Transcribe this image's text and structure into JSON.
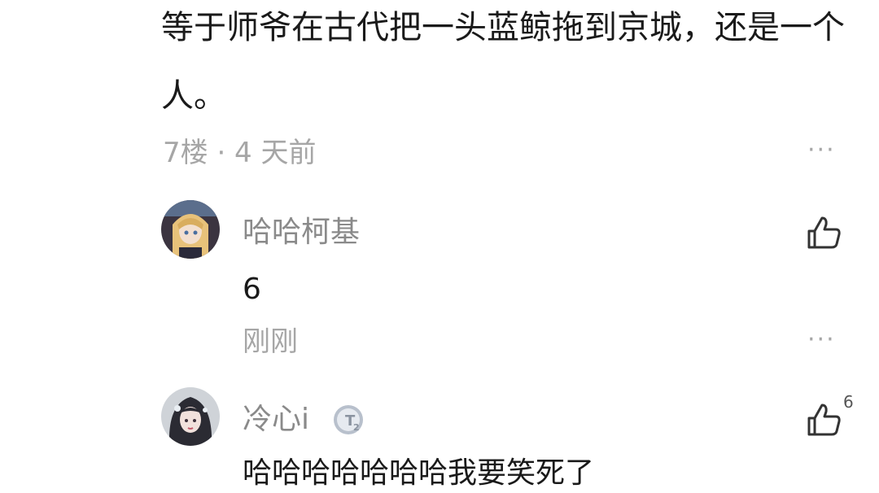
{
  "post": {
    "text": "等于师爷在古代把一头蓝鲸拖到京城，还是一个人。",
    "floor_time": "7楼 · 4 天前"
  },
  "replies": [
    {
      "username": "哈哈柯基",
      "text": "6",
      "time": "刚刚",
      "like_count": ""
    },
    {
      "username": "冷心i",
      "badge_letter": "T",
      "badge_level": "2",
      "text": "哈哈哈哈哈哈哈我要笑死了",
      "like_count": "6"
    }
  ],
  "more_glyph": "···",
  "icons": {
    "more": "more-dots-icon",
    "like": "thumbs-up-icon",
    "badge": "level-badge-icon"
  }
}
